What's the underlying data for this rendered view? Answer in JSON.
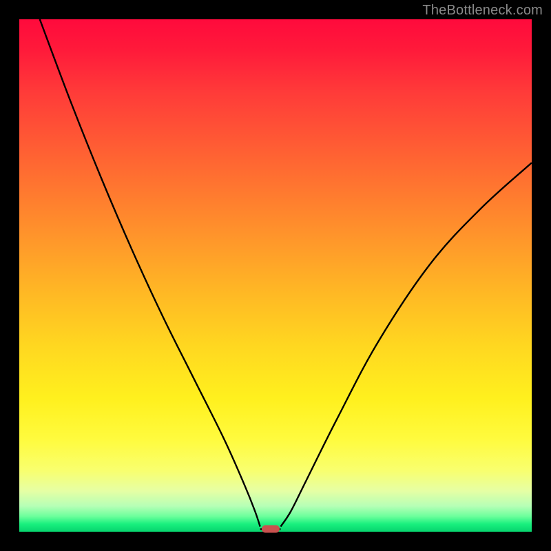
{
  "watermark": "TheBottleneck.com",
  "chart_data": {
    "type": "line",
    "title": "",
    "xlabel": "",
    "ylabel": "",
    "xlim": [
      0,
      100
    ],
    "ylim": [
      0,
      100
    ],
    "grid": false,
    "legend": false,
    "background_gradient": {
      "direction": "vertical",
      "stops": [
        {
          "pos": 0.0,
          "color": "#ff0a3c"
        },
        {
          "pos": 0.5,
          "color": "#ffba24"
        },
        {
          "pos": 0.82,
          "color": "#fffb3e"
        },
        {
          "pos": 0.95,
          "color": "#b6ffb6"
        },
        {
          "pos": 1.0,
          "color": "#07d46e"
        }
      ]
    },
    "series": [
      {
        "name": "left-branch",
        "x": [
          4,
          10,
          16,
          22,
          28,
          34,
          40,
          44,
          46,
          47
        ],
        "y": [
          100,
          84,
          69,
          55,
          42,
          30,
          18,
          9,
          4,
          1
        ]
      },
      {
        "name": "right-branch",
        "x": [
          51,
          53,
          56,
          62,
          70,
          80,
          90,
          100
        ],
        "y": [
          1,
          4,
          10,
          22,
          37,
          52,
          63,
          72
        ]
      }
    ],
    "marker": {
      "x": 49,
      "y": 0.5,
      "color": "#c9514e"
    },
    "flat_bottom": {
      "x_start": 47,
      "x_end": 51,
      "y": 0.5
    }
  }
}
